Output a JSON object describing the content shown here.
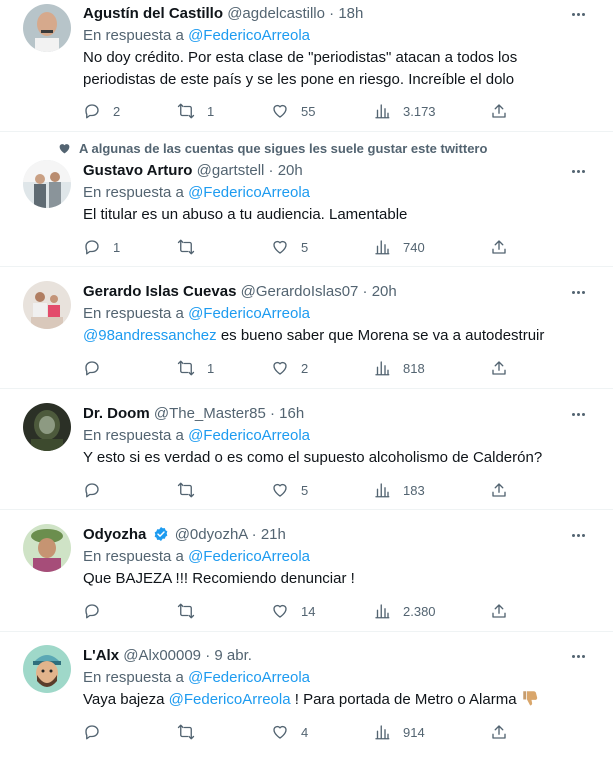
{
  "feed": {
    "social_context": "A algunas de las cuentas que sigues les suele gustar este twittero",
    "tweets": [
      {
        "name": "Agustín del Castillo",
        "handle": "@agdelcastillo",
        "dot": "·",
        "time": "18h",
        "reply_prefix": "En respuesta a",
        "reply_to": "@FedericoArreola",
        "body_mention": "",
        "text": "No doy crédito. Por esta clase de \"periodistas\" atacan a todos los periodistas de este país y se les pone en riesgo. Increíble el dolo",
        "replies": "2",
        "retweets": "1",
        "likes": "55",
        "views": "3.173"
      },
      {
        "name": "Gustavo Arturo",
        "handle": "@gartstell",
        "dot": "·",
        "time": "20h",
        "reply_prefix": "En respuesta a",
        "reply_to": "@FedericoArreola",
        "body_mention": "",
        "text": "El titular es un abuso a tu audiencia. Lamentable",
        "replies": "1",
        "retweets": "",
        "likes": "5",
        "views": "740"
      },
      {
        "name": "Gerardo Islas Cuevas",
        "handle": "@GerardoIslas07",
        "dot": "·",
        "time": "20h",
        "reply_prefix": "En respuesta a",
        "reply_to": "@FedericoArreola",
        "body_mention": "@98andressanchez",
        "text": " es bueno saber que Morena se va a autodestruir",
        "replies": "",
        "retweets": "1",
        "likes": "2",
        "views": "818"
      },
      {
        "name": "Dr. Doom",
        "handle": "@The_Master85",
        "dot": "·",
        "time": "16h",
        "reply_prefix": "En respuesta a",
        "reply_to": "@FedericoArreola",
        "body_mention": "",
        "text": "Y esto si es verdad o es como el supuesto alcoholismo de Calderón?",
        "replies": "",
        "retweets": "",
        "likes": "5",
        "views": "183"
      },
      {
        "name": "Odyozha",
        "handle": "@0dyozhA",
        "dot": "·",
        "time": "21h",
        "reply_prefix": "En respuesta a",
        "reply_to": "@FedericoArreola",
        "body_mention": "",
        "text": "Que BAJEZA !!! Recomiendo denunciar !",
        "replies": "",
        "retweets": "",
        "likes": "14",
        "views": "2.380"
      },
      {
        "name": "L'Alx",
        "handle": "@Alx00009",
        "dot": "·",
        "time": "9 abr.",
        "reply_prefix": "En respuesta a",
        "reply_to": "@FedericoArreola",
        "text_pre": "Vaya bajeza ",
        "text_mention": "@FedericoArreola",
        "text_post": " ! Para portada de Metro o Alarma ",
        "replies": "",
        "retweets": "",
        "likes": "4",
        "views": "914"
      }
    ]
  },
  "icons": {
    "reply": "reply-icon",
    "retweet": "retweet-icon",
    "like": "heart-icon",
    "views": "views-chart-icon",
    "share": "share-icon",
    "more": "more-dots-icon",
    "verified": "verified-badge-icon",
    "social": "heart-icon",
    "emoji": "thumbs-down-emoji"
  },
  "colors": {
    "text": "#0f1419",
    "secondary": "#536471",
    "accent": "#1d9bf0",
    "divider": "#eff3f4",
    "verified": "#1d9bf0"
  }
}
